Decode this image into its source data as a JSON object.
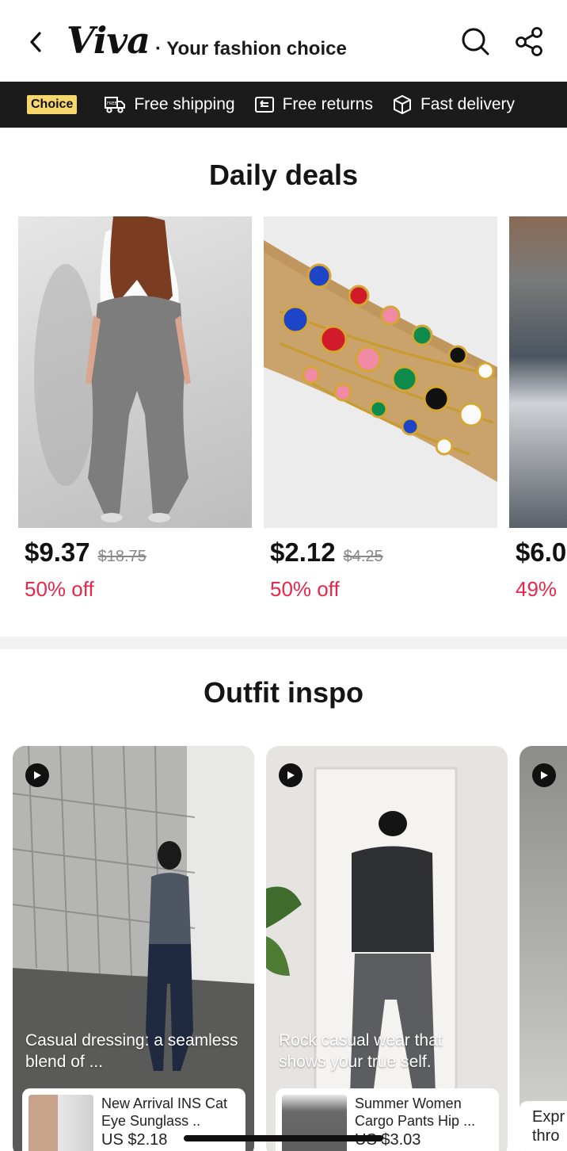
{
  "header": {
    "logo": "Viva",
    "tagline": "· Your fashion choice"
  },
  "choice_bar": {
    "badge": "Choice",
    "free_badge": "FREE",
    "items": [
      "Free shipping",
      "Free returns",
      "Fast delivery"
    ]
  },
  "daily_deals": {
    "title": "Daily deals",
    "items": [
      {
        "price": "$9.37",
        "original": "$18.75",
        "discount": "50% off"
      },
      {
        "price": "$2.12",
        "original": "$4.25",
        "discount": "50% off"
      },
      {
        "price": "$6.0",
        "original": "",
        "discount": "49%"
      }
    ]
  },
  "outfit_inspo": {
    "title": "Outfit inspo",
    "cards": [
      {
        "caption": "Casual dressing: a seamless blend of ...",
        "product_title": "New Arrival INS Cat Eye Sunglass ..",
        "product_price": "US $2.18"
      },
      {
        "caption": "Rock casual wear that shows your true self.",
        "product_title": "Summer Women Cargo Pants Hip ...",
        "product_price": "US $3.03"
      },
      {
        "caption": "",
        "product_title": "Expr thro",
        "product_price": ""
      }
    ]
  },
  "colors": {
    "accent_red": "#e8274b",
    "choice_yellow": "#f5d76e",
    "bar_dark": "#1b1b1b"
  },
  "icons": [
    "back-arrow-icon",
    "search-icon",
    "share-icon",
    "truck-icon",
    "return-icon",
    "box-icon",
    "play-icon"
  ]
}
